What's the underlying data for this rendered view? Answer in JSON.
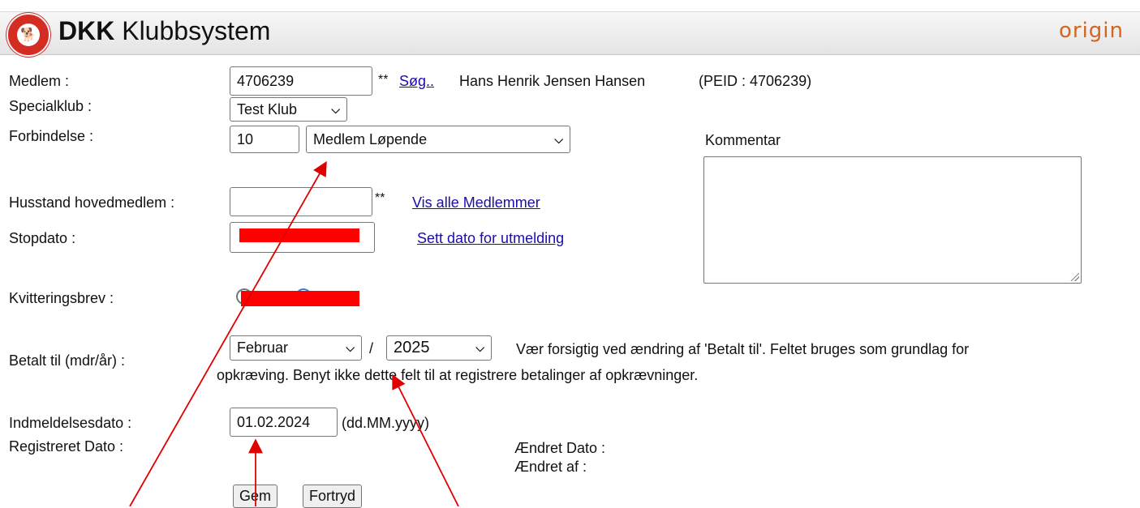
{
  "header": {
    "logo_text": "DKK",
    "title_bold": "DKK",
    "title_rest": " Klubbsystem",
    "brand": "origin"
  },
  "form": {
    "medlem": {
      "label": "Medlem :",
      "value": "4706239",
      "stars": "**",
      "search_link": "Søg..",
      "member_name": "Hans Henrik Jensen Hansen",
      "peid": "(PEID : 4706239)"
    },
    "specialklub": {
      "label": "Specialklub :",
      "selected": "Test Klub"
    },
    "forbindelse": {
      "label": "Forbindelse :",
      "code": "10",
      "selected": "Medlem Løpende"
    },
    "kommentar": {
      "label": "Kommentar",
      "value": ""
    },
    "husstand": {
      "label": "Husstand hovedmedlem :",
      "value": "",
      "stars": "**",
      "link": "Vis alle Medlemmer"
    },
    "stopdato": {
      "label": "Stopdato :",
      "link": "Sett dato for utmelding"
    },
    "kvittering": {
      "label": "Kvitteringsbrev :"
    },
    "betalt": {
      "label": "Betalt til (mdr/år) :",
      "month": "Februar",
      "separator": "/",
      "year": "2025",
      "note_line1": "Vær forsigtig ved ændring af 'Betalt til'. Feltet bruges som grundlag for",
      "note_line2": "opkræving. Benyt ikke dette felt til at registrere betalinger af opkrævninger."
    },
    "indmeldelse": {
      "label": "Indmeldelsesdato :",
      "value": "01.02.2024",
      "format": "(dd.MM.yyyy)"
    },
    "registreret": {
      "label": "Registreret Dato :"
    },
    "aendret_dato": {
      "label": "Ændret Dato :"
    },
    "aendret_af": {
      "label": "Ændret af :"
    },
    "buttons": {
      "save": "Gem",
      "cancel": "Fortryd"
    }
  },
  "annotation_color": "#e00000"
}
